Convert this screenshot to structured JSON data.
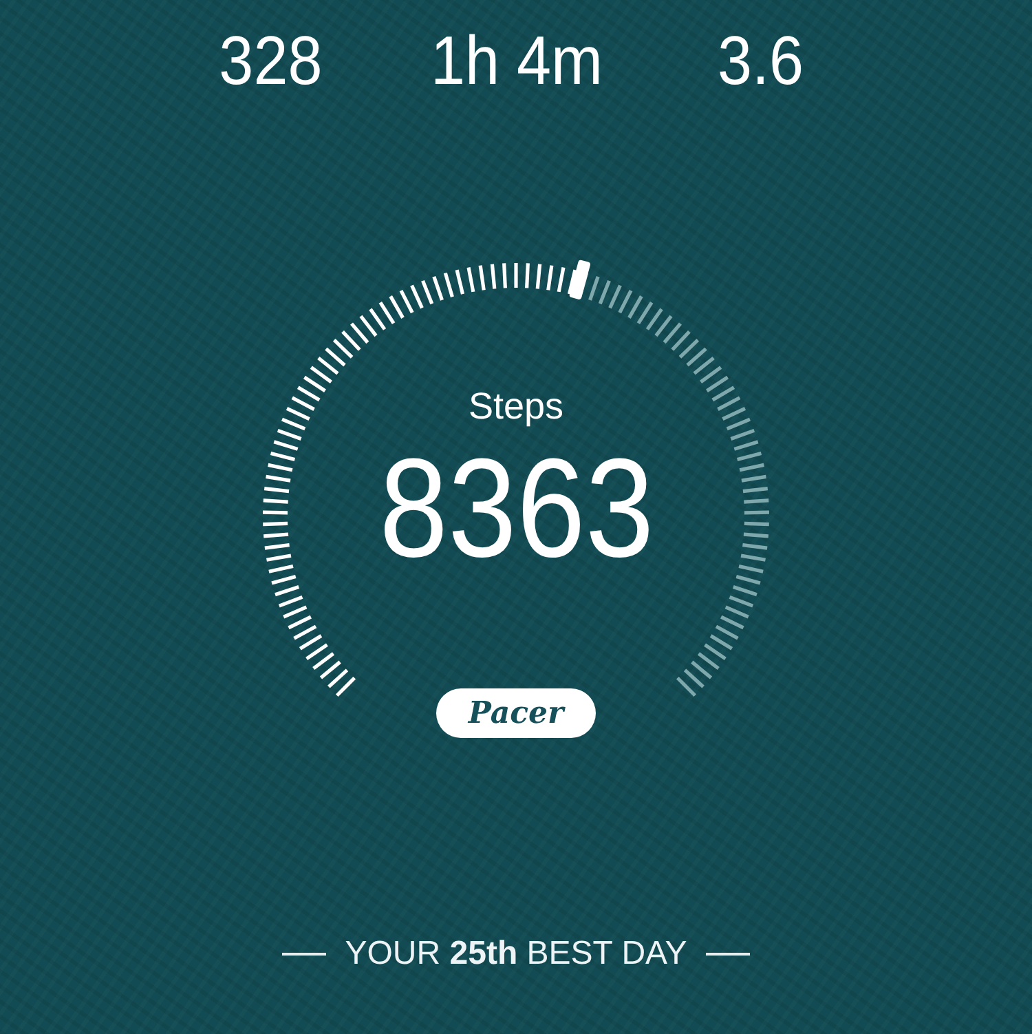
{
  "stats": [
    {
      "value": "328"
    },
    {
      "value": "1h 4m"
    },
    {
      "value": "3.6"
    }
  ],
  "gauge": {
    "label": "Steps",
    "value": "8363"
  },
  "logo": "Pacer",
  "rank": "YOUR **25th** BEST DAY"
}
